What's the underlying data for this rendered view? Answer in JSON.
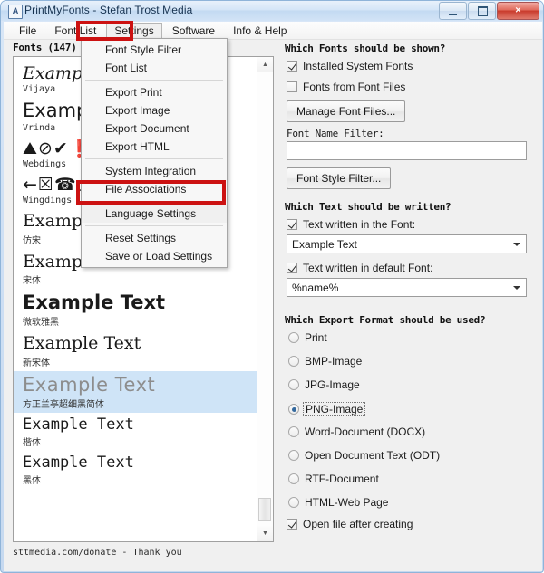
{
  "window": {
    "title": "PrintMyFonts - Stefan Trost Media",
    "app_icon": "app-icon",
    "controls": {
      "minimize": "minimize",
      "maximize": "maximize",
      "close": "×"
    }
  },
  "menubar": {
    "items": [
      {
        "label": "File",
        "active": false
      },
      {
        "label": "Font List",
        "active": false
      },
      {
        "label": "Settings",
        "active": true
      },
      {
        "label": "Software",
        "active": false
      },
      {
        "label": "Info & Help",
        "active": false
      }
    ]
  },
  "dropdown": {
    "open_for": "Settings",
    "groups": [
      [
        "Font Style Filter",
        "Font List"
      ],
      [
        "Export Print",
        "Export Image",
        "Export Document",
        "Export HTML"
      ],
      [
        "System Integration",
        "File Associations"
      ],
      [
        "Language Settings"
      ],
      [
        "Reset Settings",
        "Save or Load Settings"
      ]
    ],
    "highlighted": "Language Settings"
  },
  "annotations": {
    "color": "#cc1212",
    "boxes": [
      "Settings",
      "Language Settings"
    ]
  },
  "left_panel": {
    "fonts_label": "Fonts (147)",
    "status": "sttmedia.com/donate - Thank you",
    "scrollbar": {
      "up": "▲",
      "down": "▼"
    },
    "fonts": [
      {
        "sample": "Example Text",
        "name": "Vijaya",
        "style": "s-serif-italic",
        "name_cjk": false,
        "selected": false
      },
      {
        "sample": "Example Text",
        "name": "Vrinda",
        "style": "s-sans",
        "name_cjk": false,
        "selected": false
      },
      {
        "sample": "⛰⊘✔❗",
        "name": "Webdings",
        "style": "s-sym",
        "name_cjk": false,
        "selected": false
      },
      {
        "sample": "←☒☎○",
        "name": "Wingdings",
        "style": "s-sym",
        "name_cjk": false,
        "selected": false
      },
      {
        "sample": "Example Text",
        "name": "仿宋",
        "style": "s-serif",
        "name_cjk": true,
        "selected": false
      },
      {
        "sample": "Example Text",
        "name": "宋体",
        "style": "s-serif",
        "name_cjk": true,
        "selected": false
      },
      {
        "sample": "Example Text",
        "name": "微软雅黑",
        "style": "s-bold",
        "name_cjk": true,
        "selected": false
      },
      {
        "sample": "Example Text",
        "name": "新宋体",
        "style": "s-serif",
        "name_cjk": true,
        "selected": false
      },
      {
        "sample": "Example Text",
        "name": "方正兰亭超细黑简体",
        "style": "s-thin",
        "name_cjk": true,
        "selected": true
      },
      {
        "sample": "Example Text",
        "name": "楷体",
        "style": "s-mono",
        "name_cjk": true,
        "selected": false
      },
      {
        "sample": "Example Text",
        "name": "黑体",
        "style": "s-mono",
        "name_cjk": true,
        "selected": false
      }
    ]
  },
  "right_panel": {
    "fonts_shown": {
      "heading": "Which Fonts should be shown?",
      "installed_system_fonts": {
        "label": "Installed System Fonts",
        "checked": true
      },
      "fonts_from_font_files": {
        "label": "Fonts from Font Files",
        "checked": false
      },
      "manage_font_files_button": "Manage Font Files...",
      "font_name_filter_label": "Font Name Filter:",
      "font_name_filter_value": "",
      "font_style_filter_button": "Font Style Filter..."
    },
    "text_written": {
      "heading": "Which Text should be written?",
      "in_font": {
        "label": "Text written in the Font:",
        "checked": true,
        "value": "Example Text"
      },
      "in_default_font": {
        "label": "Text written in default Font:",
        "checked": true,
        "value": "%name%"
      }
    },
    "export_format": {
      "heading": "Which Export Format should be used?",
      "options": [
        {
          "label": "Print",
          "selected": false
        },
        {
          "label": "BMP-Image",
          "selected": false
        },
        {
          "label": "JPG-Image",
          "selected": false
        },
        {
          "label": "PNG-Image",
          "selected": true
        },
        {
          "label": "Word-Document (DOCX)",
          "selected": false
        },
        {
          "label": "Open Document Text (ODT)",
          "selected": false
        },
        {
          "label": "RTF-Document",
          "selected": false
        },
        {
          "label": "HTML-Web Page",
          "selected": false
        }
      ],
      "open_file_after_creating": {
        "label": "Open file after creating",
        "checked": true
      }
    }
  }
}
